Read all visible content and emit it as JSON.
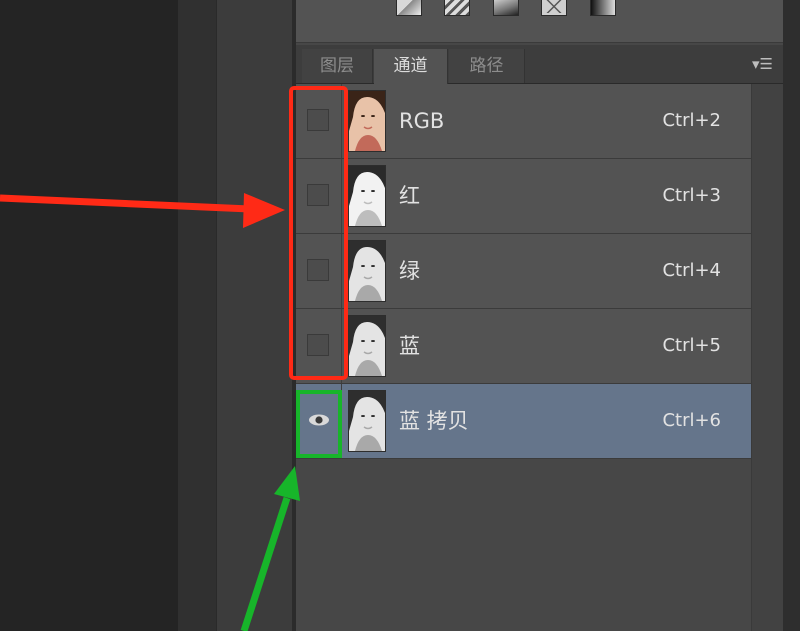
{
  "tabs": {
    "layers": "图层",
    "channels": "通道",
    "paths": "路径"
  },
  "panel_menu_icon": "panel-menu-icon",
  "toolbar_icons": [
    "adjustment-icon-1",
    "adjustment-icon-2",
    "adjustment-icon-3",
    "adjustment-icon-4",
    "gradient-map-icon"
  ],
  "channels": [
    {
      "name": "RGB",
      "shortcut": "Ctrl+2",
      "visible": false,
      "selected": false,
      "thumb": "color"
    },
    {
      "name": "红",
      "shortcut": "Ctrl+3",
      "visible": false,
      "selected": false,
      "thumb": "light"
    },
    {
      "name": "绿",
      "shortcut": "Ctrl+4",
      "visible": false,
      "selected": false,
      "thumb": "mid"
    },
    {
      "name": "蓝",
      "shortcut": "Ctrl+5",
      "visible": false,
      "selected": false,
      "thumb": "mid"
    },
    {
      "name": "蓝 拷贝",
      "shortcut": "Ctrl+6",
      "visible": true,
      "selected": true,
      "thumb": "mid"
    }
  ],
  "colors": {
    "panel_bg": "#474747",
    "row_bg": "#535353",
    "selected_row_bg": "#65758b",
    "annotation_red": "#ff2a16",
    "annotation_green": "#17b52a"
  }
}
